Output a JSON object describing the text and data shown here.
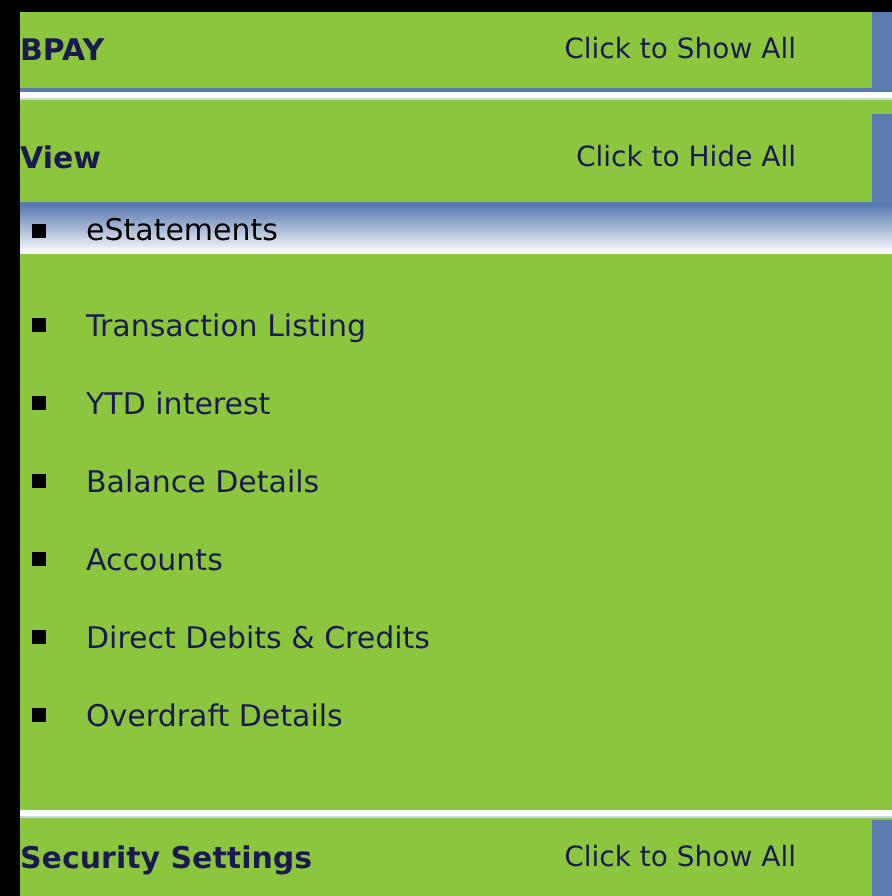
{
  "sections": [
    {
      "title": "BPAY",
      "action": "Click to Show All",
      "expanded": false
    },
    {
      "title": "View",
      "action": "Click to Hide All",
      "expanded": true,
      "items": [
        {
          "label": "eStatements",
          "selected": true
        },
        {
          "label": "Transaction Listing",
          "selected": false
        },
        {
          "label": "YTD interest",
          "selected": false
        },
        {
          "label": "Balance Details",
          "selected": false
        },
        {
          "label": "Accounts",
          "selected": false
        },
        {
          "label": "Direct Debits & Credits",
          "selected": false
        },
        {
          "label": "Overdraft Details",
          "selected": false
        }
      ]
    },
    {
      "title": "Security Settings",
      "action": "Click to Show All",
      "expanded": false
    }
  ]
}
